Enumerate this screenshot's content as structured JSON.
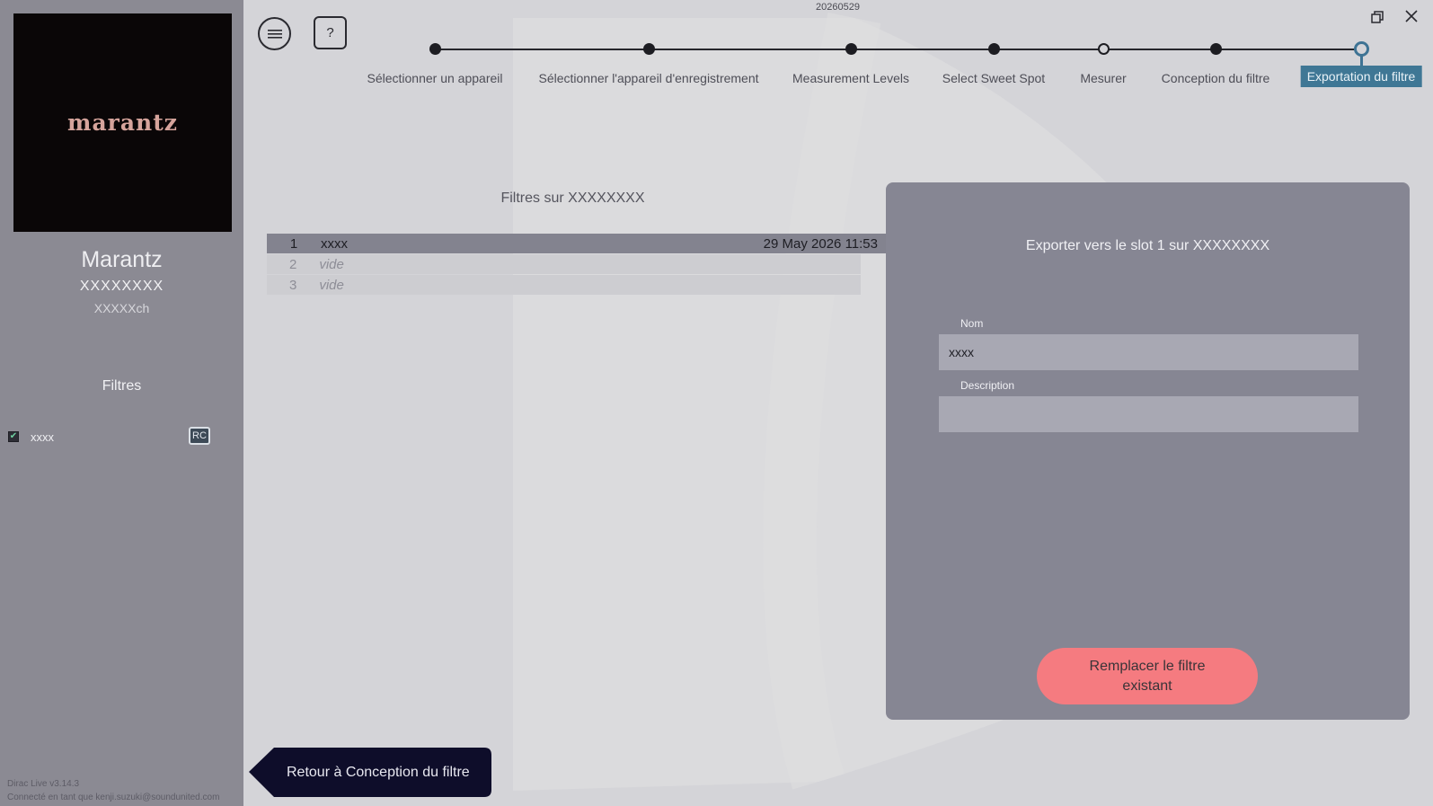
{
  "app": {
    "build_date": "20260529",
    "version_line": "Dirac Live v3.14.3",
    "user_line": "Connecté en tant que kenji.suzuki@soundunited.com"
  },
  "sidebar": {
    "logo_text": "marantz",
    "device_brand": "Marantz",
    "device_model": "XXXXXXXX",
    "device_channels": "XXXXXch",
    "filters_heading": "Filtres",
    "filters": [
      {
        "name": "xxxx",
        "checked": true,
        "badge": "RC"
      }
    ]
  },
  "header": {
    "help_label": "?",
    "menu_icon": "hamburger-icon",
    "restore_icon": "window-restore-icon",
    "close_icon": "close-icon"
  },
  "stepper": {
    "steps": [
      {
        "label": "Sélectionner un appareil",
        "state": "done"
      },
      {
        "label": "Sélectionner l'appareil d'enregistrement",
        "state": "done"
      },
      {
        "label": "Measurement Levels",
        "state": "done"
      },
      {
        "label": "Select Sweet Spot",
        "state": "done"
      },
      {
        "label": "Mesurer",
        "state": "hollow"
      },
      {
        "label": "Conception du filtre",
        "state": "done"
      },
      {
        "label": "Exportation du filtre",
        "state": "active"
      }
    ]
  },
  "slots": {
    "title": "Filtres sur XXXXXXXX",
    "rows": [
      {
        "num": "1",
        "name": "xxxx",
        "date": "29 May 2026 11:53",
        "selected": true
      },
      {
        "num": "2",
        "name": "vide",
        "date": "",
        "selected": false
      },
      {
        "num": "3",
        "name": "vide",
        "date": "",
        "selected": false
      }
    ]
  },
  "export_panel": {
    "title": "Exporter vers le slot 1 sur XXXXXXXX",
    "name_label": "Nom",
    "name_value": "xxxx",
    "description_label": "Description",
    "description_value": "",
    "replace_button": "Remplacer le filtre\nexistant"
  },
  "footer": {
    "back_button": "Retour à Conception du filtre"
  },
  "colors": {
    "sidebar_bg": "#8b8a93",
    "page_bg": "#d4d4d8",
    "panel_bg": "#868693",
    "accent_active": "#3f7795",
    "replace_button": "#f57b80",
    "back_button": "#0e0d2a"
  }
}
